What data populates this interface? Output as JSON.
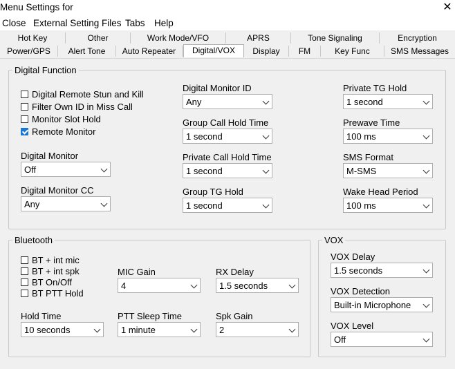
{
  "window": {
    "title": "Menu Settings for"
  },
  "menu": [
    "Close",
    "External Setting Files",
    "Tabs",
    "Help"
  ],
  "tabs": {
    "row_top": [
      "Hot Key",
      "Other",
      "Work Mode/VFO",
      "APRS",
      "Tone Signaling",
      "Encryption"
    ],
    "row_bottom": [
      "Power/GPS",
      "Alert Tone",
      "Auto Repeater",
      "Digital/VOX",
      "Display",
      "FM",
      "Key Func",
      "SMS Messages"
    ],
    "active": "Digital/VOX"
  },
  "digital_function": {
    "title": "Digital Function",
    "checkboxes": [
      {
        "label": "Digital Remote Stun and Kill",
        "checked": false
      },
      {
        "label": "Filter Own ID in Miss Call",
        "checked": false
      },
      {
        "label": "Monitor Slot Hold",
        "checked": false
      },
      {
        "label": "Remote Monitor",
        "checked": true
      }
    ],
    "digital_monitor": {
      "label": "Digital Monitor",
      "value": "Off"
    },
    "digital_monitor_cc": {
      "label": "Digital Monitor CC",
      "value": "Any"
    },
    "digital_monitor_id": {
      "label": "Digital Monitor ID",
      "value": "Any"
    },
    "group_call_hold_time": {
      "label": "Group Call Hold Time",
      "value": "1 second"
    },
    "private_call_hold_time": {
      "label": "Private Call Hold Time",
      "value": "1 second"
    },
    "group_tg_hold": {
      "label": "Group TG Hold",
      "value": "1 second"
    },
    "private_tg_hold": {
      "label": "Private TG Hold",
      "value": "1 second"
    },
    "prewave_time": {
      "label": "Prewave Time",
      "value": "100 ms"
    },
    "sms_format": {
      "label": "SMS Format",
      "value": "M-SMS"
    },
    "wake_head_period": {
      "label": "Wake Head Period",
      "value": "100 ms"
    }
  },
  "bluetooth": {
    "title": "Bluetooth",
    "checkboxes": [
      {
        "label": "BT + int mic",
        "checked": false
      },
      {
        "label": "BT + int spk",
        "checked": false
      },
      {
        "label": "BT On/Off",
        "checked": false
      },
      {
        "label": "BT PTT Hold",
        "checked": false
      }
    ],
    "mic_gain": {
      "label": "MIC Gain",
      "value": "4"
    },
    "rx_delay": {
      "label": "RX Delay",
      "value": "1.5 seconds"
    },
    "hold_time": {
      "label": "Hold Time",
      "value": "10 seconds"
    },
    "ptt_sleep_time": {
      "label": "PTT Sleep Time",
      "value": "1 minute"
    },
    "spk_gain": {
      "label": "Spk Gain",
      "value": "2"
    }
  },
  "vox": {
    "title": "VOX",
    "vox_delay": {
      "label": "VOX Delay",
      "value": "1.5 seconds"
    },
    "vox_detection": {
      "label": "VOX Detection",
      "value": "Built-in Microphone"
    },
    "vox_level": {
      "label": "VOX Level",
      "value": "Off"
    }
  }
}
